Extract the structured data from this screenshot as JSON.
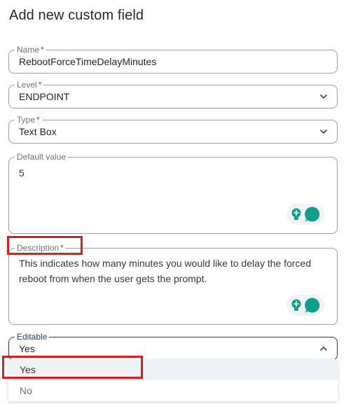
{
  "title": "Add new custom field",
  "fields": {
    "name": {
      "label": "Name",
      "required_mark": "*",
      "value": "RebootForceTimeDelayMinutes"
    },
    "level": {
      "label": "Level",
      "required_mark": "*",
      "value": "ENDPOINT",
      "icon": "chevron-down-icon"
    },
    "type": {
      "label": "Type",
      "required_mark": "*",
      "value": "Text Box",
      "icon": "chevron-down-icon"
    },
    "default_value": {
      "label": "Default value",
      "value": "5"
    },
    "description": {
      "label": "Description",
      "required_mark": "*",
      "value": "This indicates how many minutes you would like to delay the forced reboot from when the user gets the prompt."
    },
    "editable": {
      "label": "Editable",
      "value": "Yes",
      "icon": "chevron-up-icon"
    }
  },
  "editable_options": [
    "Yes",
    "No"
  ],
  "editable_selected_option": "Yes",
  "colors": {
    "accent": "#1e3a8a",
    "highlight": "#e01b1b",
    "ai_icon": "#0f9f8c",
    "required": "#d93025",
    "border": "#9aa0a6"
  }
}
